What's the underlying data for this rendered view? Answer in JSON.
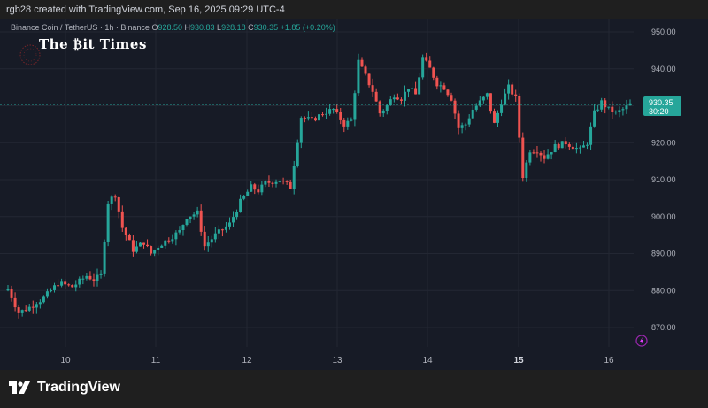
{
  "header": {
    "caption": "rgb28 created with TradingView.com, Sep 16, 2025 09:29 UTC-4"
  },
  "legend": {
    "symbol": "Binance Coin / TetherUS · 1h · Binance",
    "open_key": "O",
    "open": "928.50",
    "high_key": "H",
    "high": "930.83",
    "low_key": "L",
    "low": "928.18",
    "close_key": "C",
    "close": "930.35",
    "change": "+1.85 (+0.20%)"
  },
  "watermark": {
    "text": "The ₿it Times"
  },
  "price_tag": {
    "price": "930.35",
    "countdown": "30:20"
  },
  "footer": {
    "brand": "TradingView"
  },
  "colors": {
    "up": "#26a69a",
    "down": "#ef5350",
    "background": "#171b26",
    "grid": "#232733",
    "axis_text": "#b2b5be",
    "price_line": "#26a69a"
  },
  "chart_data": {
    "type": "candlestick",
    "x_ticks": [
      "10",
      "11",
      "12",
      "13",
      "14",
      "15",
      "16"
    ],
    "x_tick_bold": [
      false,
      false,
      false,
      false,
      false,
      true,
      false
    ],
    "y_ticks": [
      "870.00",
      "880.00",
      "890.00",
      "900.00",
      "910.00",
      "920.00",
      "930.00",
      "940.00",
      "950.00"
    ],
    "ylim": [
      865,
      953
    ],
    "last_price": 930.35,
    "close_path": [
      [
        0,
        880.5
      ],
      [
        3,
        874
      ],
      [
        6,
        875.5
      ],
      [
        10,
        878
      ],
      [
        14,
        882
      ],
      [
        18,
        881
      ],
      [
        22,
        884
      ],
      [
        24,
        883
      ],
      [
        26,
        884
      ],
      [
        28,
        904
      ],
      [
        30,
        906
      ],
      [
        32,
        897
      ],
      [
        35,
        891
      ],
      [
        38,
        893
      ],
      [
        40,
        890
      ],
      [
        42,
        892
      ],
      [
        45,
        894
      ],
      [
        48,
        896
      ],
      [
        50,
        900
      ],
      [
        53,
        901
      ],
      [
        55,
        892
      ],
      [
        58,
        895
      ],
      [
        62,
        898
      ],
      [
        65,
        904
      ],
      [
        68,
        908
      ],
      [
        70,
        907
      ],
      [
        72,
        909
      ],
      [
        76,
        910
      ],
      [
        79,
        908
      ],
      [
        82,
        927
      ],
      [
        85,
        926
      ],
      [
        88,
        928
      ],
      [
        91,
        929
      ],
      [
        94,
        925
      ],
      [
        96,
        926
      ],
      [
        98,
        942
      ],
      [
        100,
        938
      ],
      [
        102,
        934
      ],
      [
        104,
        928
      ],
      [
        106,
        930
      ],
      [
        108,
        933
      ],
      [
        110,
        932
      ],
      [
        112,
        935
      ],
      [
        114,
        933
      ],
      [
        116,
        943
      ],
      [
        118,
        940
      ],
      [
        120,
        936
      ],
      [
        122,
        935
      ],
      [
        124,
        932
      ],
      [
        126,
        924
      ],
      [
        128,
        925
      ],
      [
        130,
        929
      ],
      [
        132,
        931
      ],
      [
        134,
        933
      ],
      [
        136,
        925
      ],
      [
        138,
        931
      ],
      [
        140,
        935
      ],
      [
        142,
        932
      ],
      [
        144,
        911
      ],
      [
        146,
        918
      ],
      [
        148,
        918
      ],
      [
        150,
        916
      ],
      [
        153,
        919
      ],
      [
        156,
        920
      ],
      [
        158,
        919
      ],
      [
        160,
        918
      ],
      [
        162,
        920
      ],
      [
        164,
        928
      ],
      [
        166,
        931
      ],
      [
        168,
        929
      ],
      [
        170,
        928
      ],
      [
        172,
        929
      ],
      [
        174,
        930.35
      ]
    ]
  }
}
